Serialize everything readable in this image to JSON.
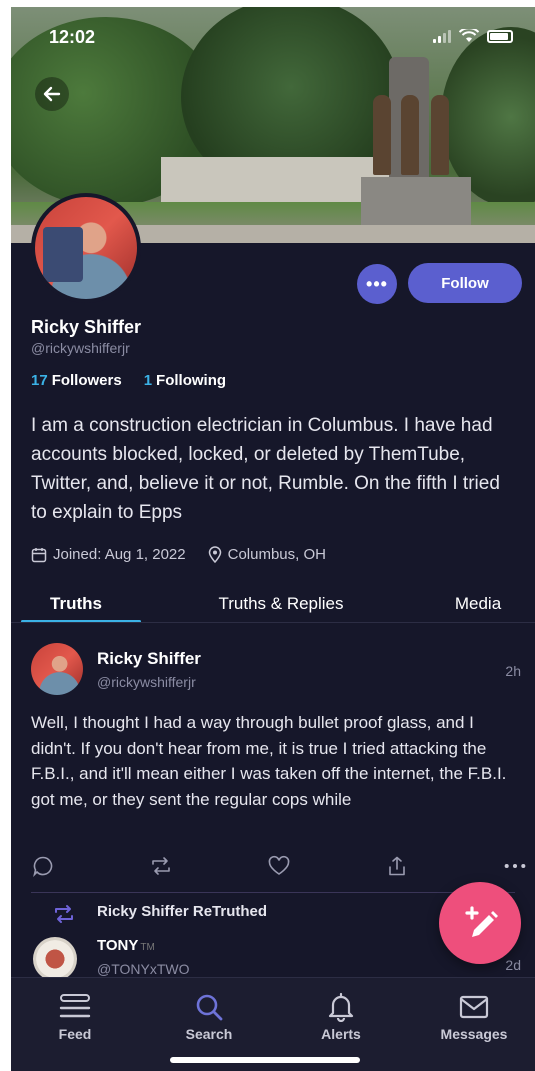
{
  "status_bar": {
    "time": "12:02"
  },
  "profile": {
    "display_name": "Ricky Shiffer",
    "handle": "@rickywshifferjr",
    "followers_count": "17",
    "followers_label": "Followers",
    "following_count": "1",
    "following_label": "Following",
    "bio": "I am a construction electrician in Columbus. I have had accounts blocked, locked, or deleted by ThemTube, Twitter, and, believe it or not, Rumble. On the fifth I tried to explain to Epps",
    "joined": "Joined: Aug 1, 2022",
    "location": "Columbus, OH",
    "more_label": "•••",
    "follow_label": "Follow"
  },
  "tabs": [
    {
      "label": "Truths"
    },
    {
      "label": "Truths & Replies"
    },
    {
      "label": "Media"
    }
  ],
  "post": {
    "name": "Ricky Shiffer",
    "handle": "@rickywshifferjr",
    "time": "2h",
    "text": "Well, I thought I had a way through bullet proof glass, and I didn't. If you don't hear from me, it is true I tried attacking the F.B.I., and it'll mean either I was taken off the internet, the F.B.I. got me, or they sent the regular cops while"
  },
  "retruth": {
    "label": "Ricky Shiffer ReTruthed",
    "name": "TONY",
    "tm": "TM",
    "handle": "@TONYxTWO",
    "time": "2d"
  },
  "tabbar": [
    {
      "label": "Feed"
    },
    {
      "label": "Search"
    },
    {
      "label": "Alerts"
    },
    {
      "label": "Messages"
    }
  ],
  "colors": {
    "background": "#16172a",
    "accent": "#5b5fcf",
    "link": "#3bb2e6",
    "fab": "#ee4f7c"
  }
}
